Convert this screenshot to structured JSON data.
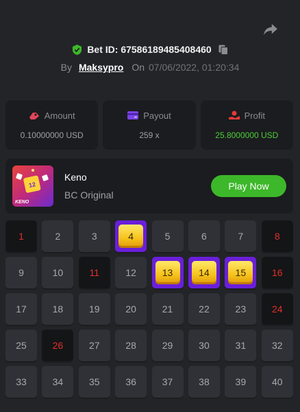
{
  "header": {
    "bet_id": "Bet ID: 67586189485408460",
    "by_label": "By",
    "username": "Maksypro",
    "on_label": "On",
    "datetime": "07/06/2022, 01:20:34"
  },
  "stats": {
    "amount_label": "Amount",
    "amount_value": "0.10000000 USD",
    "payout_label": "Payout",
    "payout_value": "259 x",
    "profit_label": "Profit",
    "profit_value": "25.8000000 USD"
  },
  "game": {
    "name": "Keno",
    "provider": "BC Original",
    "play_label": "Play Now",
    "thumb_label": "KENO",
    "thumb_number": "12"
  },
  "board": {
    "cells": [
      {
        "n": "1",
        "state": "miss"
      },
      {
        "n": "2",
        "state": ""
      },
      {
        "n": "3",
        "state": ""
      },
      {
        "n": "4",
        "state": "hit"
      },
      {
        "n": "5",
        "state": ""
      },
      {
        "n": "6",
        "state": ""
      },
      {
        "n": "7",
        "state": ""
      },
      {
        "n": "8",
        "state": "miss"
      },
      {
        "n": "9",
        "state": ""
      },
      {
        "n": "10",
        "state": ""
      },
      {
        "n": "11",
        "state": "miss"
      },
      {
        "n": "12",
        "state": ""
      },
      {
        "n": "13",
        "state": "hit"
      },
      {
        "n": "14",
        "state": "hit"
      },
      {
        "n": "15",
        "state": "hit"
      },
      {
        "n": "16",
        "state": "miss"
      },
      {
        "n": "17",
        "state": ""
      },
      {
        "n": "18",
        "state": ""
      },
      {
        "n": "19",
        "state": ""
      },
      {
        "n": "20",
        "state": ""
      },
      {
        "n": "21",
        "state": ""
      },
      {
        "n": "22",
        "state": ""
      },
      {
        "n": "23",
        "state": ""
      },
      {
        "n": "24",
        "state": "miss"
      },
      {
        "n": "25",
        "state": ""
      },
      {
        "n": "26",
        "state": "miss"
      },
      {
        "n": "27",
        "state": ""
      },
      {
        "n": "28",
        "state": ""
      },
      {
        "n": "29",
        "state": ""
      },
      {
        "n": "30",
        "state": ""
      },
      {
        "n": "31",
        "state": ""
      },
      {
        "n": "32",
        "state": ""
      },
      {
        "n": "33",
        "state": ""
      },
      {
        "n": "34",
        "state": ""
      },
      {
        "n": "35",
        "state": ""
      },
      {
        "n": "36",
        "state": ""
      },
      {
        "n": "37",
        "state": ""
      },
      {
        "n": "38",
        "state": ""
      },
      {
        "n": "39",
        "state": ""
      },
      {
        "n": "40",
        "state": ""
      }
    ]
  },
  "colors": {
    "background": "#232428",
    "panel": "#1b1c1f",
    "accent_green": "#3db82a",
    "profit_green": "#4ccf37",
    "miss_red": "#e0302a",
    "hit_purple": "#6a1fd9",
    "hit_gold": "#f6c21b"
  },
  "icons": [
    "share-icon",
    "shield-check-icon",
    "copy-icon",
    "amount-icon",
    "payout-icon",
    "profit-icon"
  ]
}
